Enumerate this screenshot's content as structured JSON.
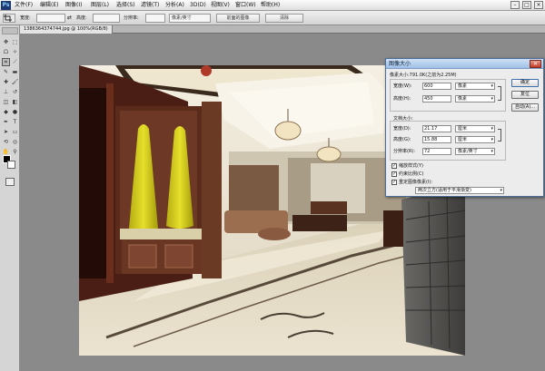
{
  "app": {
    "logo": "Ps"
  },
  "menubar": {
    "items": [
      "文件(F)",
      "编辑(E)",
      "图像(I)",
      "图层(L)",
      "选择(S)",
      "滤镜(T)",
      "分析(A)",
      "3D(D)",
      "视图(V)",
      "窗口(W)",
      "帮助(H)"
    ],
    "window_controls": [
      "–",
      "□",
      "×"
    ]
  },
  "options_bar": {
    "feather_label": "宽度:",
    "height_label": "高度:",
    "resolution_label": "分辨率:",
    "unit_value": "像素/英寸",
    "front_image_button": "前面的图像",
    "clear_button": "清除"
  },
  "document": {
    "tab_title": "1386364374744.jpg @ 100%(RGB/8)"
  },
  "dialog": {
    "title": "图像大小",
    "pixel_dimensions": "像素大小:791.0K(之前为2.25M)",
    "width_label": "宽度(W):",
    "width_value": "600",
    "width_unit": "像素",
    "height_label": "高度(H):",
    "height_value": "450",
    "height_unit": "像素",
    "doc_size_label": "文档大小:",
    "doc_width_label": "宽度(D):",
    "doc_width_value": "21.17",
    "doc_width_unit": "厘米",
    "doc_height_label": "高度(G):",
    "doc_height_value": "15.88",
    "doc_height_unit": "厘米",
    "resolution_label": "分辨率(R):",
    "resolution_value": "72",
    "resolution_unit": "像素/英寸",
    "scale_styles": "缩放样式(Y)",
    "constrain": "约束比例(C)",
    "resample": "重定图像像素(I):",
    "resample_method": "两次立方(适用于平滑渐变)",
    "ok": "确定",
    "reset": "复位",
    "auto": "自动(A)..."
  },
  "colors": {
    "background": "#8a8a8a",
    "dialog_title": "#9fc0e6",
    "photo_coat": "#d8d21a"
  }
}
